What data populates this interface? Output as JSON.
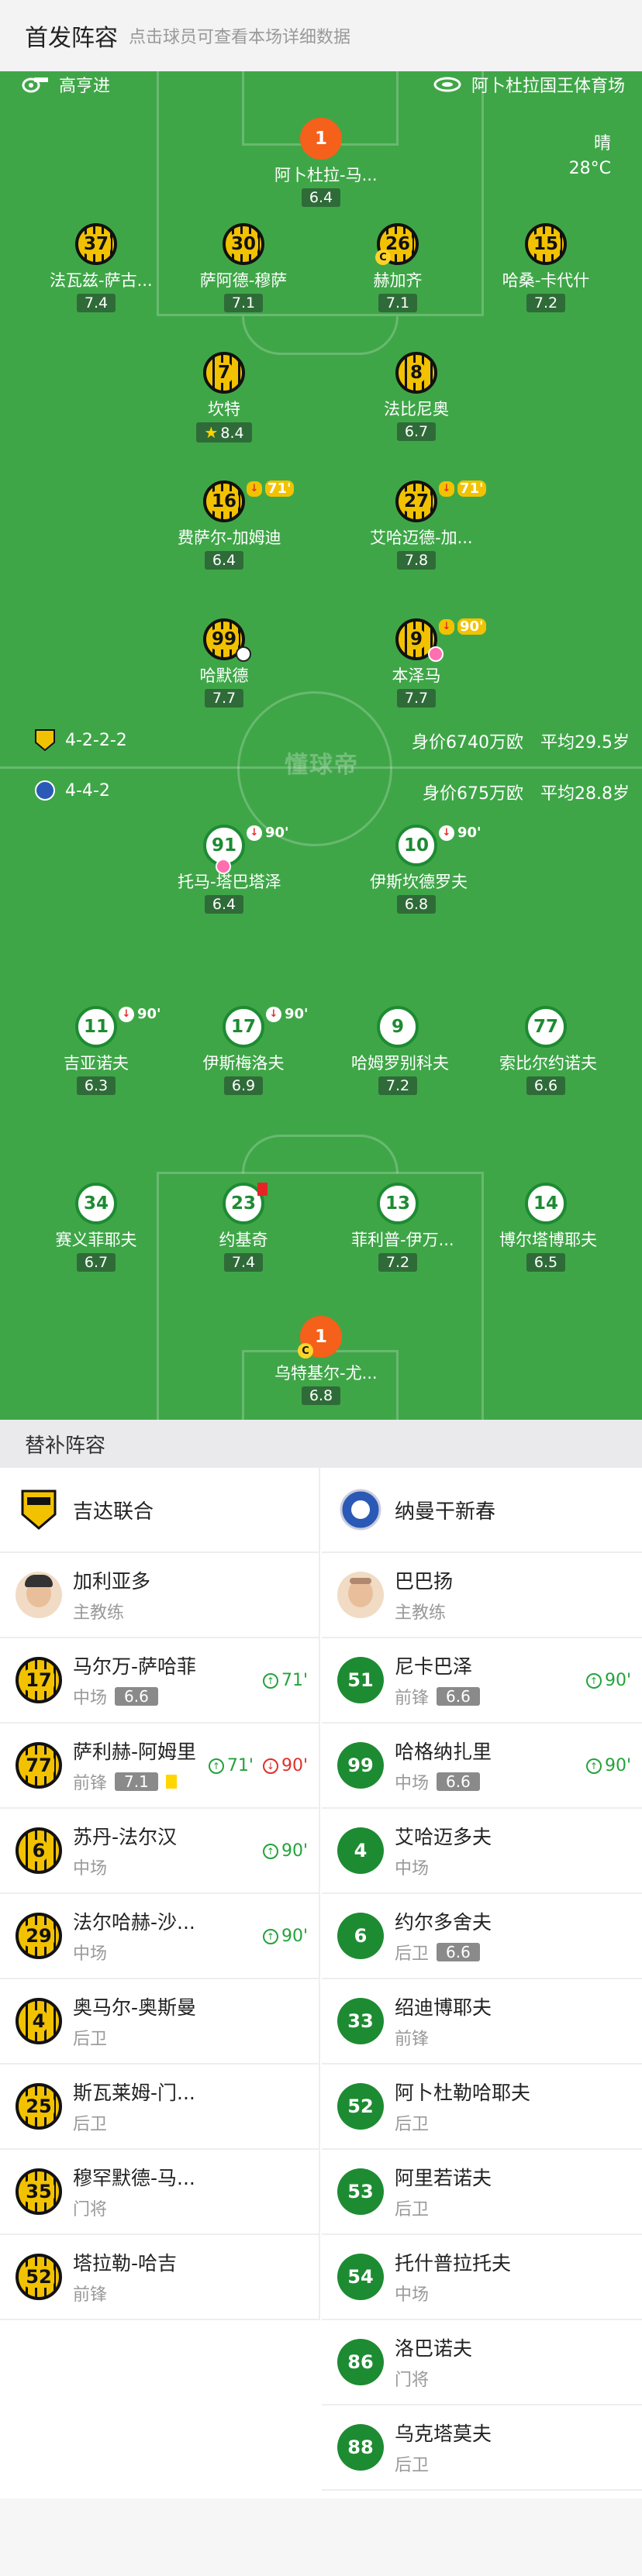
{
  "header": {
    "title": "首发阵容",
    "subtitle": "点击球员可查看本场详细数据"
  },
  "match": {
    "referee": "高亨进",
    "stadium": "阿卜杜拉国王体育场",
    "weather": "晴",
    "temperature": "28°C",
    "watermark": "懂球帝"
  },
  "home": {
    "formation": "4-2-2-2",
    "value": "身价6740万欧",
    "age": "平均29.5岁",
    "players": [
      {
        "num": "1",
        "name": "阿卜杜拉-马...",
        "rating": "6.4",
        "gk": true
      },
      {
        "num": "37",
        "name": "法瓦兹-萨古...",
        "rating": "7.4"
      },
      {
        "num": "30",
        "name": "萨阿德-穆萨",
        "rating": "7.1"
      },
      {
        "num": "26",
        "name": "赫加齐",
        "rating": "7.1",
        "captain": "C"
      },
      {
        "num": "15",
        "name": "哈桑-卡代什",
        "rating": "7.2"
      },
      {
        "num": "7",
        "name": "坎特",
        "rating": "8.4",
        "mvp": true
      },
      {
        "num": "8",
        "name": "法比尼奥",
        "rating": "6.7"
      },
      {
        "num": "16",
        "name": "费萨尔-加姆迪",
        "rating": "6.4",
        "sub": "71'"
      },
      {
        "num": "27",
        "name": "艾哈迈德-加...",
        "rating": "7.8",
        "sub": "71'"
      },
      {
        "num": "99",
        "name": "哈默德",
        "rating": "7.7",
        "goal": true
      },
      {
        "num": "9",
        "name": "本泽马",
        "rating": "7.7",
        "sub": "90'",
        "goal": true
      }
    ]
  },
  "away": {
    "formation": "4-4-2",
    "value": "身价675万欧",
    "age": "平均28.8岁",
    "players": [
      {
        "num": "91",
        "name": "托马-塔巴塔泽",
        "rating": "6.4",
        "sub": "90'"
      },
      {
        "num": "10",
        "name": "伊斯坎德罗夫",
        "rating": "6.8",
        "sub": "90'"
      },
      {
        "num": "11",
        "name": "吉亚诺夫",
        "rating": "6.3",
        "sub": "90'"
      },
      {
        "num": "17",
        "name": "伊斯梅洛夫",
        "rating": "6.9",
        "sub": "90'"
      },
      {
        "num": "9",
        "name": "哈姆罗别科夫",
        "rating": "7.2"
      },
      {
        "num": "77",
        "name": "索比尔约诺夫",
        "rating": "6.6"
      },
      {
        "num": "34",
        "name": "赛义菲耶夫",
        "rating": "6.7"
      },
      {
        "num": "23",
        "name": "约基奇",
        "rating": "7.4",
        "red": true
      },
      {
        "num": "13",
        "name": "菲利普-伊万...",
        "rating": "7.2"
      },
      {
        "num": "14",
        "name": "博尔塔博耶夫",
        "rating": "6.5"
      },
      {
        "num": "1",
        "name": "乌特基尔-尤...",
        "rating": "6.8",
        "gk": true,
        "captain": "C"
      }
    ]
  },
  "subs_section": {
    "title": "替补阵容"
  },
  "subs": {
    "left": {
      "team": "吉达联合",
      "coach": {
        "name": "加利亚多",
        "role": "主教练"
      },
      "rows": [
        {
          "num": "17",
          "name": "马尔万-萨哈菲",
          "pos": "中场",
          "rating": "6.6",
          "in": "71'"
        },
        {
          "num": "77",
          "name": "萨利赫-阿姆里",
          "pos": "前锋",
          "rating": "7.1",
          "in": "71'",
          "out": "90'",
          "yellow": true
        },
        {
          "num": "6",
          "name": "苏丹-法尔汉",
          "pos": "中场",
          "in": "90'"
        },
        {
          "num": "29",
          "name": "法尔哈赫-沙...",
          "pos": "中场",
          "in": "90'"
        },
        {
          "num": "4",
          "name": "奥马尔-奥斯曼",
          "pos": "后卫"
        },
        {
          "num": "25",
          "name": "斯瓦莱姆-门...",
          "pos": "后卫"
        },
        {
          "num": "35",
          "name": "穆罕默德-马...",
          "pos": "门将"
        },
        {
          "num": "52",
          "name": "塔拉勒-哈吉",
          "pos": "前锋"
        }
      ]
    },
    "right": {
      "team": "纳曼干新春",
      "coach": {
        "name": "巴巴扬",
        "role": "主教练"
      },
      "rows": [
        {
          "num": "51",
          "name": "尼卡巴泽",
          "pos": "前锋",
          "rating": "6.6",
          "in": "90'"
        },
        {
          "num": "99",
          "name": "哈格纳扎里",
          "pos": "中场",
          "rating": "6.6",
          "in": "90'"
        },
        {
          "num": "4",
          "name": "艾哈迈多夫",
          "pos": "中场"
        },
        {
          "num": "6",
          "name": "约尔多舍夫",
          "pos": "后卫",
          "rating": "6.6"
        },
        {
          "num": "33",
          "name": "绍迪博耶夫",
          "pos": "前锋"
        },
        {
          "num": "52",
          "name": "阿卜杜勒哈耶夫",
          "pos": "后卫"
        },
        {
          "num": "53",
          "name": "阿里若诺夫",
          "pos": "后卫"
        },
        {
          "num": "54",
          "name": "托什普拉托夫",
          "pos": "中场"
        },
        {
          "num": "86",
          "name": "洛巴诺夫",
          "pos": "门将"
        },
        {
          "num": "88",
          "name": "乌克塔莫夫",
          "pos": "后卫"
        }
      ]
    }
  },
  "colors": {
    "pitch": "#3fa648",
    "home": "#f2c200",
    "away": "#1d8b32",
    "gk": "#f5601a"
  }
}
